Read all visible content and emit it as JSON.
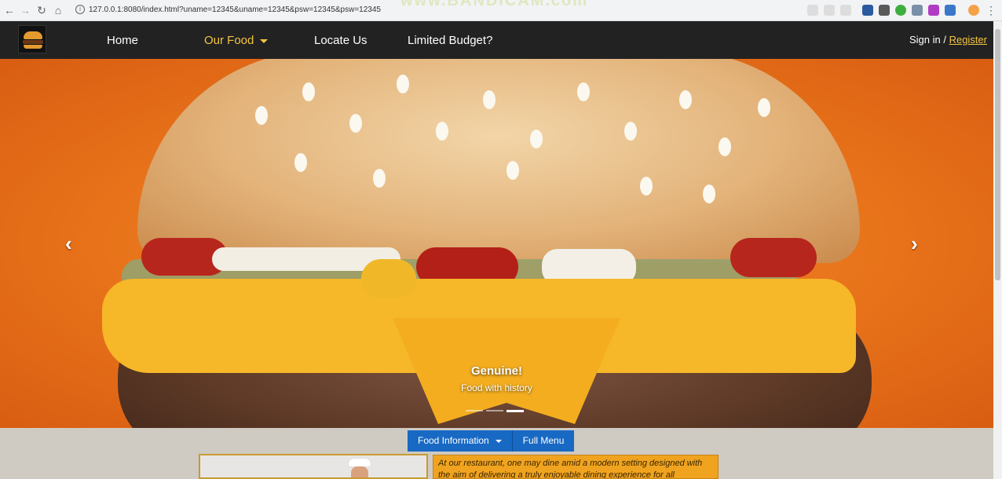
{
  "browser": {
    "url": "127.0.0.1:8080/index.html?uname=12345&uname=12345&psw=12345&psw=12345",
    "watermark": "www.BANDICAM.com"
  },
  "navbar": {
    "links": [
      "Home",
      "Our Food",
      "Locate Us",
      "Limited Budget?"
    ],
    "active_link": "Our Food",
    "auth": {
      "signin": "Sign in",
      "separator": "/",
      "register": "Register"
    }
  },
  "carousel": {
    "caption_title": "Genuine!",
    "caption_subtitle": "Food with history",
    "prev_icon": "chevron-left-icon",
    "next_icon": "chevron-right-icon",
    "slide_count": 3,
    "active_slide": 3
  },
  "content": {
    "buttons": [
      "Food Information",
      "Full Menu"
    ],
    "info_text": "At our restaurant, one may dine amid a modern setting designed with the aim of delivering a truly enjoyable dining experience for all customers."
  },
  "colors": {
    "navbar_bg": "#222222",
    "accent_yellow": "#f4c542",
    "button_blue": "#1869c4",
    "info_orange": "#f0a31f"
  }
}
